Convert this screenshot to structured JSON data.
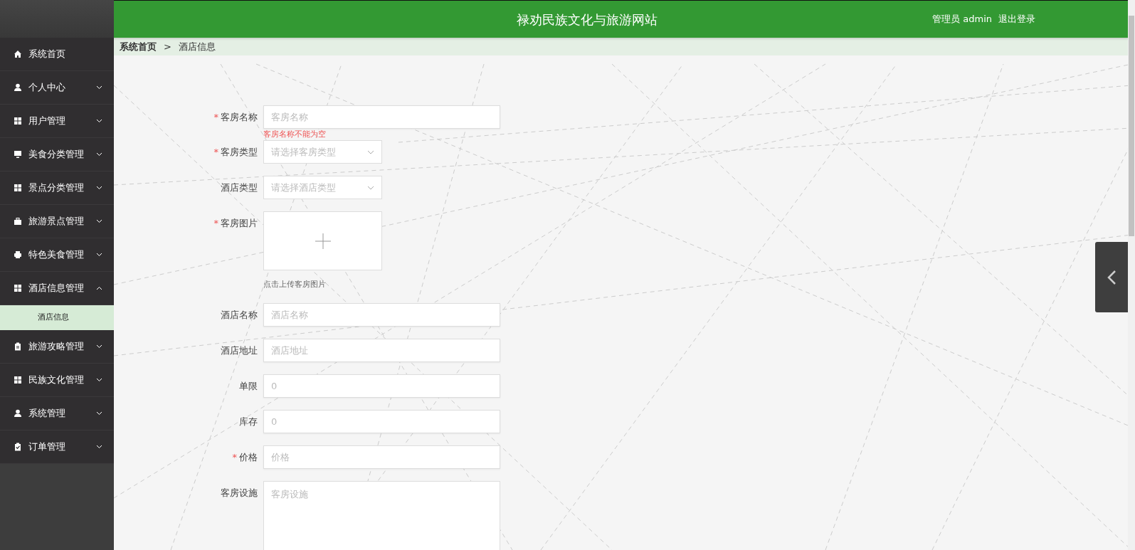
{
  "header": {
    "title": "禄劝民族文化与旅游网站",
    "user": "管理员 admin",
    "logout": "退出登录"
  },
  "breadcrumb": [
    "系统首页",
    ">",
    "酒店信息"
  ],
  "sidebar": {
    "items": [
      {
        "label": "系统首页",
        "kind": "home"
      },
      {
        "label": "个人中心",
        "kind": "user",
        "expanded": false
      },
      {
        "label": "用户管理",
        "kind": "grid",
        "expanded": false
      },
      {
        "label": "美食分类管理",
        "kind": "monitor",
        "expanded": false
      },
      {
        "label": "景点分类管理",
        "kind": "grid",
        "expanded": false
      },
      {
        "label": "旅游景点管理",
        "kind": "bag",
        "expanded": false
      },
      {
        "label": "特色美食管理",
        "kind": "printer",
        "expanded": false
      },
      {
        "label": "酒店信息管理",
        "kind": "grid",
        "expanded": true,
        "children": [
          {
            "label": "酒店信息",
            "selected": true
          }
        ]
      },
      {
        "label": "旅游攻略管理",
        "kind": "clipboard",
        "expanded": false
      },
      {
        "label": "民族文化管理",
        "kind": "grid",
        "expanded": false
      },
      {
        "label": "系统管理",
        "kind": "user",
        "expanded": false
      },
      {
        "label": "订单管理",
        "kind": "check",
        "expanded": false
      }
    ]
  },
  "form": {
    "fields": [
      {
        "kind": "input",
        "label": "客房名称",
        "required_mark": "*",
        "placeholder": "客房名称",
        "error": "客房名称不能为空"
      },
      {
        "kind": "select",
        "label": "客房类型",
        "required_mark": "*",
        "placeholder": "请选择客房类型"
      },
      {
        "kind": "select",
        "label": "酒店类型",
        "placeholder": "请选择酒店类型"
      },
      {
        "kind": "upload",
        "label": "客房图片",
        "required_mark": "*",
        "hint": "点击上传客房图片"
      },
      {
        "kind": "input",
        "label": "酒店名称",
        "placeholder": "酒店名称"
      },
      {
        "kind": "input",
        "label": "酒店地址",
        "placeholder": "酒店地址"
      },
      {
        "kind": "input",
        "label": "单限",
        "placeholder": "0"
      },
      {
        "kind": "input",
        "label": "库存",
        "placeholder": "0"
      },
      {
        "kind": "input",
        "label": "价格",
        "required_mark": "*",
        "placeholder": "价格"
      },
      {
        "kind": "textarea",
        "label": "客房设施",
        "placeholder": "客房设施"
      }
    ]
  }
}
